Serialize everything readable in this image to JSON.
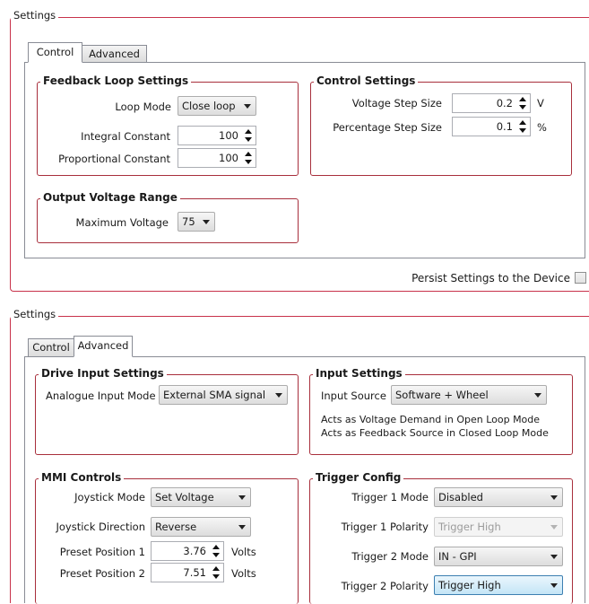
{
  "top": {
    "settings_legend": "Settings",
    "tabs": [
      {
        "label": "Control",
        "active": true
      },
      {
        "label": "Advanced",
        "active": false
      }
    ],
    "feedback": {
      "title": "Feedback Loop Settings",
      "loop_mode_label": "Loop Mode",
      "loop_mode_value": "Close loop",
      "integral_label": "Integral Constant",
      "integral_value": "100",
      "proportional_label": "Proportional Constant",
      "proportional_value": "100"
    },
    "control": {
      "title": "Control Settings",
      "voltage_step_label": "Voltage Step Size",
      "voltage_step_value": "0.2",
      "voltage_step_unit": "V",
      "percentage_step_label": "Percentage Step Size",
      "percentage_step_value": "0.1",
      "percentage_step_unit": "%"
    },
    "output": {
      "title": "Output Voltage Range",
      "max_voltage_label": "Maximum Voltage",
      "max_voltage_value": "75"
    },
    "persist_label": "Persist Settings to the Device",
    "persist_checked": false
  },
  "bottom": {
    "settings_legend": "Settings",
    "tabs": [
      {
        "label": "Control",
        "active": false
      },
      {
        "label": "Advanced",
        "active": true
      }
    ],
    "drive": {
      "title": "Drive Input Settings",
      "analogue_label": "Analogue Input Mode",
      "analogue_value": "External SMA signal"
    },
    "input": {
      "title": "Input Settings",
      "source_label": "Input Source",
      "source_value": "Software + Wheel",
      "note1": "Acts as Voltage Demand in Open Loop Mode",
      "note2": "Acts as Feedback Source in Closed Loop Mode"
    },
    "mmi": {
      "title": "MMI Controls",
      "joystick_mode_label": "Joystick Mode",
      "joystick_mode_value": "Set Voltage",
      "joystick_dir_label": "Joystick Direction",
      "joystick_dir_value": "Reverse",
      "preset1_label": "Preset Position 1",
      "preset1_value": "3.76",
      "preset1_unit": "Volts",
      "preset2_label": "Preset Position 2",
      "preset2_value": "7.51",
      "preset2_unit": "Volts"
    },
    "trigger": {
      "title": "Trigger Config",
      "t1_mode_label": "Trigger 1 Mode",
      "t1_mode_value": "Disabled",
      "t1_pol_label": "Trigger 1 Polarity",
      "t1_pol_value": "Trigger High",
      "t2_mode_label": "Trigger 2 Mode",
      "t2_mode_value": "IN - GPI",
      "t2_pol_label": "Trigger 2 Polarity",
      "t2_pol_value": "Trigger High"
    }
  }
}
